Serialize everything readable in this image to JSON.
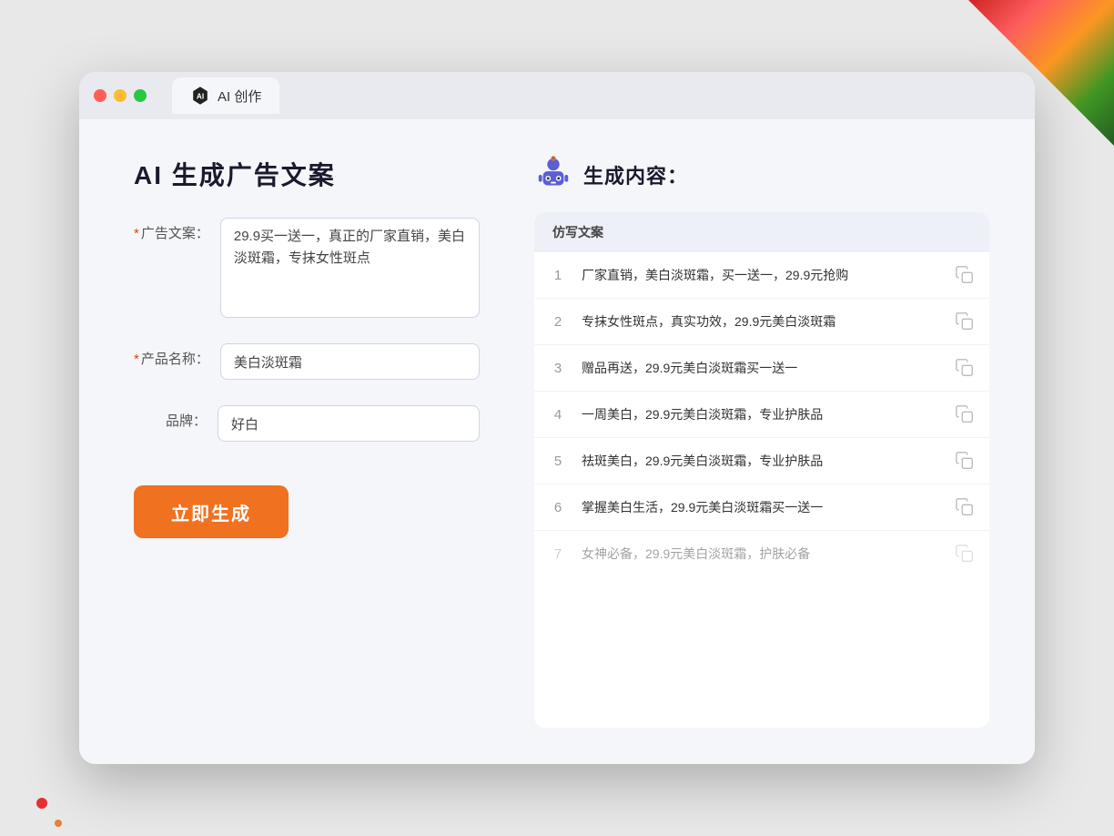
{
  "browser": {
    "tab_label": "AI 创作",
    "traffic_lights": [
      "red",
      "yellow",
      "green"
    ]
  },
  "left_panel": {
    "page_title": "AI 生成广告文案",
    "form": {
      "ad_copy_label": "广告文案：",
      "ad_copy_required": true,
      "ad_copy_value": "29.9买一送一，真正的厂家直销，美白淡斑霜，专抹女性斑点",
      "product_name_label": "产品名称：",
      "product_name_required": true,
      "product_name_value": "美白淡斑霜",
      "brand_label": "品牌：",
      "brand_required": false,
      "brand_value": "好白"
    },
    "generate_button": "立即生成"
  },
  "right_panel": {
    "title": "生成内容：",
    "column_header": "仿写文案",
    "results": [
      {
        "num": 1,
        "text": "厂家直销，美白淡斑霜，买一送一，29.9元抢购",
        "faded": false
      },
      {
        "num": 2,
        "text": "专抹女性斑点，真实功效，29.9元美白淡斑霜",
        "faded": false
      },
      {
        "num": 3,
        "text": "赠品再送，29.9元美白淡斑霜买一送一",
        "faded": false
      },
      {
        "num": 4,
        "text": "一周美白，29.9元美白淡斑霜，专业护肤品",
        "faded": false
      },
      {
        "num": 5,
        "text": "祛斑美白，29.9元美白淡斑霜，专业护肤品",
        "faded": false
      },
      {
        "num": 6,
        "text": "掌握美白生活，29.9元美白淡斑霜买一送一",
        "faded": false
      },
      {
        "num": 7,
        "text": "女神必备，29.9元美白淡斑霜，护肤必备",
        "faded": true
      }
    ]
  }
}
